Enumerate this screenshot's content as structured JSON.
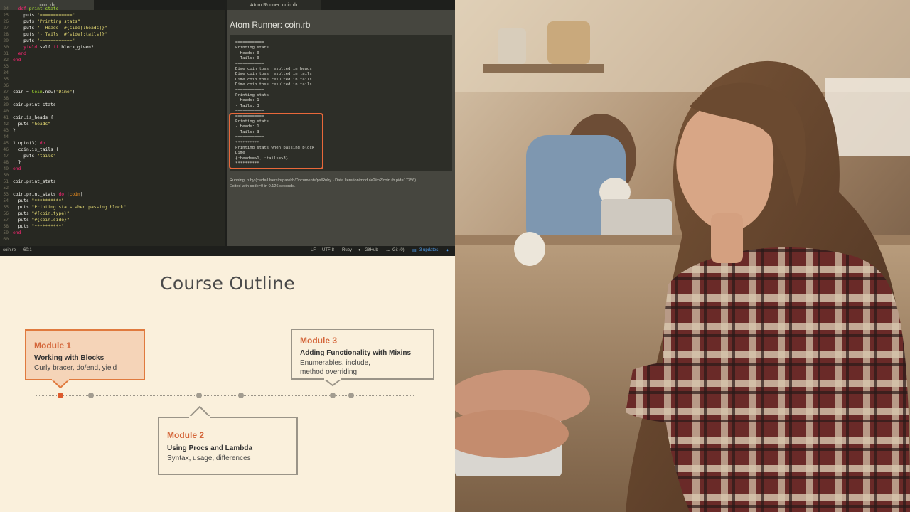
{
  "editor": {
    "tabs": [
      "coin.rb",
      "Atom Runner: coin.rb"
    ],
    "code_lines": [
      {
        "n": "24",
        "html": "  <span class='k'>def</span> <span class='c'>print_stats</span>"
      },
      {
        "n": "25",
        "html": "    puts <span class='s'>\"============\"</span>"
      },
      {
        "n": "26",
        "html": "    puts <span class='s'>\"Printing stats\"</span>"
      },
      {
        "n": "27",
        "html": "    puts <span class='s'>\"- Heads: #{side[:heads]}\"</span>"
      },
      {
        "n": "28",
        "html": "    puts <span class='s'>\"- Tails: #{side[:tails]}\"</span>"
      },
      {
        "n": "29",
        "html": "    puts <span class='s'>\"============\"</span>"
      },
      {
        "n": "30",
        "html": "    <span class='k'>yield</span> self <span class='k'>if</span> block_given?"
      },
      {
        "n": "31",
        "html": "  <span class='k'>end</span>"
      },
      {
        "n": "32",
        "html": "<span class='k'>end</span>"
      },
      {
        "n": "33",
        "html": ""
      },
      {
        "n": "34",
        "html": ""
      },
      {
        "n": "35",
        "html": ""
      },
      {
        "n": "36",
        "html": ""
      },
      {
        "n": "37",
        "html": "coin = <span class='c'>Coin</span>.new(<span class='s'>\"Dime\"</span>)"
      },
      {
        "n": "38",
        "html": ""
      },
      {
        "n": "39",
        "html": "coin.print_stats"
      },
      {
        "n": "40",
        "html": ""
      },
      {
        "n": "41",
        "html": "coin.is_heads {"
      },
      {
        "n": "42",
        "html": "  puts <span class='s'>\"heads\"</span>"
      },
      {
        "n": "43",
        "html": "}"
      },
      {
        "n": "44",
        "html": ""
      },
      {
        "n": "45",
        "html": "1.upto(3) <span class='k'>do</span>"
      },
      {
        "n": "46",
        "html": "  coin.is_tails {"
      },
      {
        "n": "47",
        "html": "    puts <span class='s'>\"tails\"</span>"
      },
      {
        "n": "48",
        "html": "  }"
      },
      {
        "n": "49",
        "html": "<span class='k'>end</span>"
      },
      {
        "n": "50",
        "html": ""
      },
      {
        "n": "51",
        "html": "coin.print_stats"
      },
      {
        "n": "52",
        "html": ""
      },
      {
        "n": "53",
        "html": "coin.print_stats <span class='k'>do</span> |<span class='v'>coin</span>|"
      },
      {
        "n": "54",
        "html": "  puts <span class='s'>\"**********\"</span>"
      },
      {
        "n": "55",
        "html": "  puts <span class='s'>\"Printing stats when passing block\"</span>"
      },
      {
        "n": "56",
        "html": "  puts <span class='s'>\"#{coin.type}\"</span>"
      },
      {
        "n": "57",
        "html": "  puts <span class='s'>\"#{coin.side}\"</span>"
      },
      {
        "n": "58",
        "html": "  puts <span class='s'>\"**********\"</span>"
      },
      {
        "n": "59",
        "html": "<span class='k'>end</span>"
      },
      {
        "n": "60",
        "html": ""
      }
    ],
    "runner_title": "Atom Runner: coin.rb",
    "output_lines": [
      "============",
      "Printing stats",
      "- Heads: 0",
      "- Tails: 0",
      "============",
      "Dime coin toss resulted in heads",
      "Dime coin toss resulted in tails",
      "Dime coin toss resulted in tails",
      "Dime coin toss resulted in tails",
      "============",
      "Printing stats",
      "- Heads: 1",
      "- Tails: 3",
      "============",
      "============",
      "Printing stats",
      "- Heads: 1",
      "- Tails: 3",
      "============",
      "**********",
      "Printing stats when passing block",
      "Dime",
      "{:heads=>1, :tails=>3}",
      "**********"
    ],
    "run_status_1": "Running: ruby (cwd=/Users/prparekh/Documents/ps/Ruby - Data Iteration/module2/m2/coin.rb pid=17356).",
    "run_status_2": "Exited with code=0 in 0.126 seconds.",
    "status": {
      "file": "coin.rb",
      "cursor": "60:1",
      "line_ending": "LF",
      "encoding": "UTF-8",
      "grammar": "Ruby",
      "github": "GitHub",
      "git": "Git (0)",
      "updates": "3 updates"
    },
    "colors": {
      "accent": "#e9683a",
      "background": "#272822"
    }
  },
  "outline": {
    "title": "Course Outline",
    "modules": [
      {
        "title": "Module 1",
        "subtitle": "Working with Blocks",
        "desc": "Curly bracer, do/end, yield"
      },
      {
        "title": "Module 2",
        "subtitle": "Using Procs and Lambda",
        "desc": "Syntax, usage, differences"
      },
      {
        "title": "Module 3",
        "subtitle": "Adding Functionality with Mixins",
        "desc_1": "Enumerables, include,",
        "desc_2": "method overriding"
      }
    ],
    "colors": {
      "accent": "#d4663a",
      "background": "#faf0dc"
    }
  }
}
